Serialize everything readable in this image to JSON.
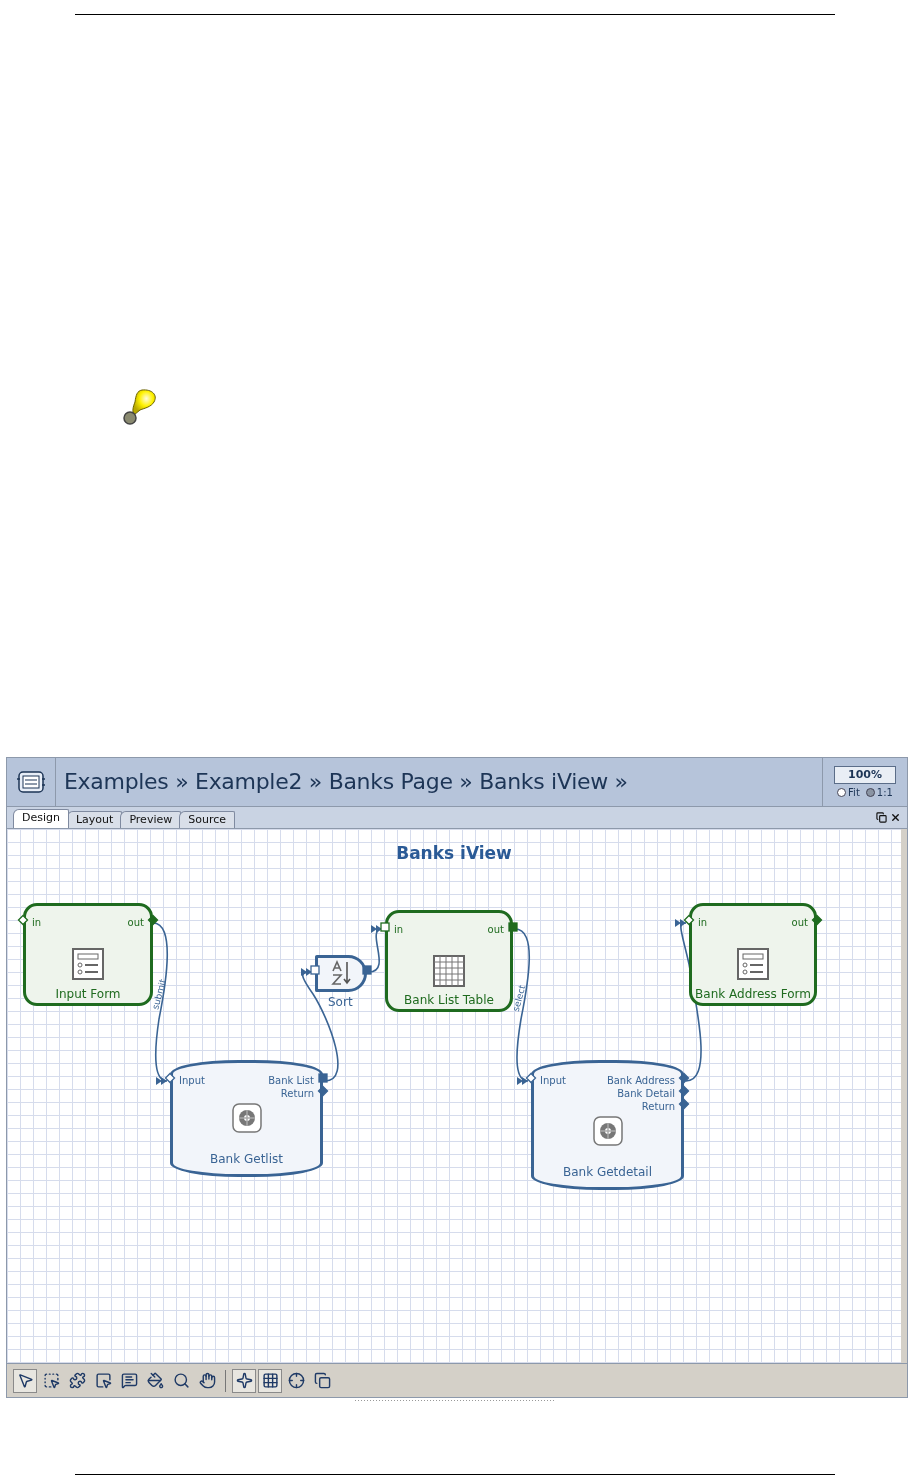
{
  "editor": {
    "breadcrumb": "Examples » Example2 » Banks Page » Banks iView »",
    "zoom": "100%",
    "zoom_modes": [
      {
        "label": "Fit",
        "selected": false
      },
      {
        "label": "1:1",
        "selected": true
      }
    ],
    "tabs": [
      {
        "label": "Design",
        "selected": true
      },
      {
        "label": "Layout",
        "selected": false
      },
      {
        "label": "Preview",
        "selected": false
      },
      {
        "label": "Source",
        "selected": false
      }
    ],
    "canvas": {
      "title": "Banks iView",
      "nodes": [
        {
          "kind": "form",
          "label": "Input Form",
          "inputs": [
            {
              "label": "in",
              "kind": "diamond",
              "filled": false
            }
          ],
          "outputs": [
            {
              "label": "out",
              "kind": "diamond",
              "filled": true
            }
          ]
        },
        {
          "kind": "sort",
          "label": "Sort",
          "inputs": [
            {
              "kind": "square",
              "filled": false
            }
          ],
          "outputs": [
            {
              "kind": "square",
              "filled": true
            }
          ]
        },
        {
          "kind": "table",
          "label": "Bank List Table",
          "inputs": [
            {
              "label": "in",
              "kind": "square",
              "filled": false
            }
          ],
          "outputs": [
            {
              "label": "out",
              "kind": "square",
              "filled": true
            }
          ]
        },
        {
          "kind": "form",
          "label": "Bank Address Form",
          "inputs": [
            {
              "label": "in",
              "kind": "diamond",
              "filled": false
            }
          ],
          "outputs": [
            {
              "label": "out",
              "kind": "diamond",
              "filled": true
            }
          ]
        },
        {
          "kind": "service",
          "label": "Bank Getlist",
          "inputs": [
            {
              "label": "Input",
              "kind": "diamond",
              "filled": false
            }
          ],
          "outputs": [
            {
              "label": "Bank List",
              "kind": "square",
              "filled": true
            },
            {
              "label": "Return",
              "kind": "diamond",
              "filled": true
            }
          ]
        },
        {
          "kind": "service",
          "label": "Bank Getdetail",
          "inputs": [
            {
              "label": "Input",
              "kind": "diamond",
              "filled": false
            }
          ],
          "outputs": [
            {
              "label": "Bank Address",
              "kind": "diamond",
              "filled": true
            },
            {
              "label": "Bank Detail",
              "kind": "diamond",
              "filled": true
            },
            {
              "label": "Return",
              "kind": "diamond",
              "filled": true
            }
          ]
        }
      ],
      "connectors": [
        {
          "kind": "labeled",
          "label": "submit"
        },
        {
          "kind": "plain"
        },
        {
          "kind": "plain"
        },
        {
          "kind": "labeled",
          "label": "select"
        },
        {
          "kind": "plain"
        }
      ]
    },
    "toolbar": [
      [
        {
          "kind": "pointer",
          "selected": true
        },
        {
          "kind": "lasso",
          "selected": false
        },
        {
          "kind": "connect",
          "selected": false
        },
        {
          "kind": "area",
          "selected": false
        },
        {
          "kind": "comment",
          "selected": false
        },
        {
          "kind": "fill",
          "selected": false
        },
        {
          "kind": "zoom",
          "selected": false
        },
        {
          "kind": "pan",
          "selected": false
        }
      ],
      [
        {
          "kind": "snap",
          "selected": true
        },
        {
          "kind": "grid",
          "selected": true
        },
        {
          "kind": "center",
          "selected": false
        },
        {
          "kind": "shadow",
          "selected": false
        }
      ]
    ]
  }
}
